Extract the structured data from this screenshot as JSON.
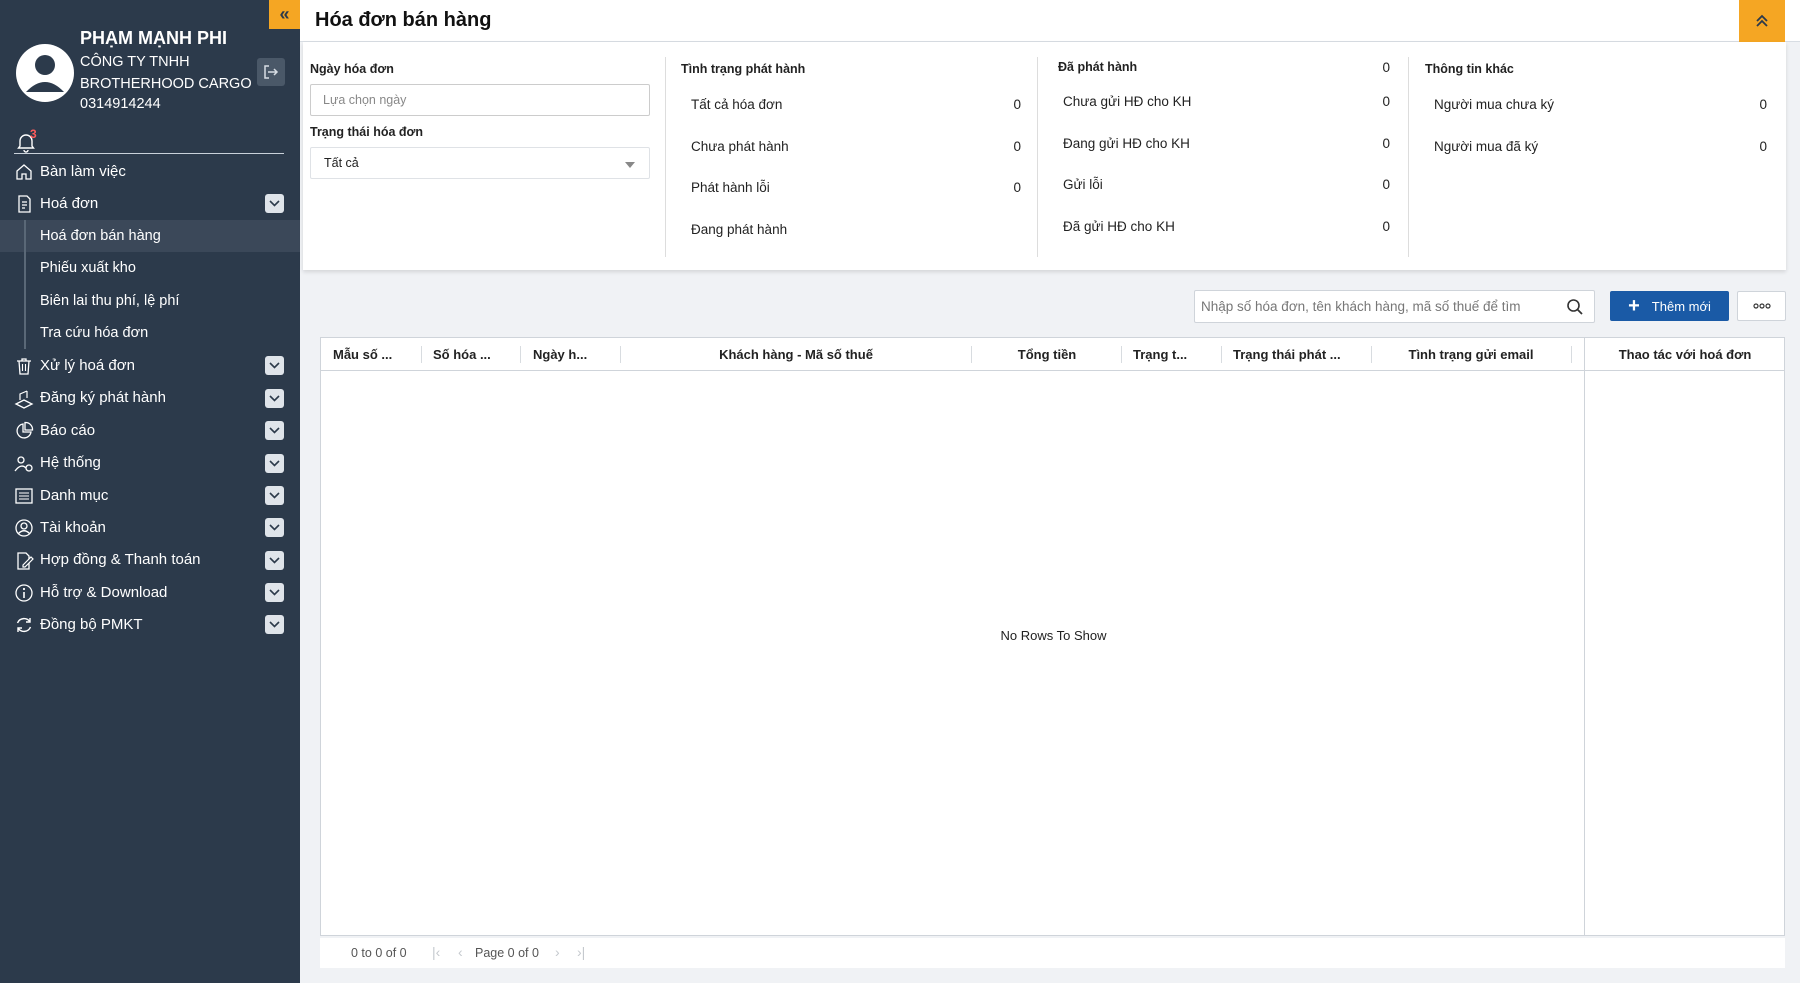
{
  "sidebar": {
    "collapse_icon": "double-chevron-left-icon",
    "user_name": "PHẠM MẠNH PHI",
    "company": "CÔNG TY TNHH BROTHERHOOD CARGO",
    "tax_code": "0314914244",
    "notification_count": "3",
    "menu": [
      {
        "label": "Bàn làm việc",
        "icon": "home-icon",
        "expandable": false
      },
      {
        "label": "Hoá đơn",
        "icon": "invoice-icon",
        "expandable": true
      }
    ],
    "submenu": [
      {
        "label": "Hoá đơn bán hàng",
        "active": true
      },
      {
        "label": "Phiếu xuất kho",
        "active": false
      },
      {
        "label": "Biên lai thu phí, lệ phí",
        "active": false
      },
      {
        "label": "Tra cứu hóa đơn",
        "active": false
      }
    ],
    "menu_rest": [
      {
        "label": "Xử lý hoá đơn",
        "icon": "trash-icon"
      },
      {
        "label": "Đăng ký phát hành",
        "icon": "register-icon"
      },
      {
        "label": "Báo cáo",
        "icon": "pie-chart-icon"
      },
      {
        "label": "Hệ thống",
        "icon": "users-gear-icon"
      },
      {
        "label": "Danh mục",
        "icon": "list-icon"
      },
      {
        "label": "Tài khoản",
        "icon": "user-circle-icon"
      },
      {
        "label": "Hợp đồng & Thanh toán",
        "icon": "contract-icon"
      },
      {
        "label": "Hỗ trợ & Download",
        "icon": "info-icon"
      },
      {
        "label": "Đồng bộ PMKT",
        "icon": "sync-icon"
      }
    ]
  },
  "header": {
    "title": "Hóa đơn bán hàng"
  },
  "filters": {
    "date_label": "Ngày hóa đơn",
    "date_placeholder": "Lựa chọn ngày",
    "status_label": "Trạng thái hóa đơn",
    "status_value": "Tất cả"
  },
  "stats": {
    "issue_status": {
      "title": "Tình trạng phát hành",
      "rows": [
        {
          "label": "Tất cả hóa đơn",
          "value": "0"
        },
        {
          "label": "Chưa phát hành",
          "value": "0"
        },
        {
          "label": "Phát hành lỗi",
          "value": "0"
        },
        {
          "label": "Đang phát hành",
          "value": ""
        }
      ]
    },
    "issued": {
      "title": "Đã phát hành",
      "total": "0",
      "rows": [
        {
          "label": "Chưa gửi HĐ cho KH",
          "value": "0"
        },
        {
          "label": "Đang gửi HĐ cho KH",
          "value": "0"
        },
        {
          "label": "Gửi lỗi",
          "value": "0"
        },
        {
          "label": "Đã gửi HĐ cho KH",
          "value": "0"
        }
      ]
    },
    "other": {
      "title": "Thông tin khác",
      "rows": [
        {
          "label": "Người mua chưa ký",
          "value": "0"
        },
        {
          "label": "Người mua đã ký",
          "value": "0"
        }
      ]
    }
  },
  "toolbar": {
    "search_placeholder": "Nhập số hóa đơn, tên khách hàng, mã số thuế để tìm",
    "add_label": "Thêm mới"
  },
  "table": {
    "columns": [
      "Mẫu số ...",
      "Số hóa ...",
      "Ngày h...",
      "Khách hàng - Mã số thuế",
      "Tổng tiền",
      "Trạng t...",
      "Trạng thái phát ...",
      "Tình trạng gửi email",
      "Thao tác với hoá đơn"
    ],
    "empty_text": "No Rows To Show"
  },
  "pager": {
    "rows_info": "0 to 0 of 0",
    "page_info": "Page 0 of 0"
  },
  "colors": {
    "sidebar_bg": "#2c3a4b",
    "accent": "#f5a623",
    "primary_button": "#1a5aa6",
    "badge": "#ff5c5c"
  }
}
